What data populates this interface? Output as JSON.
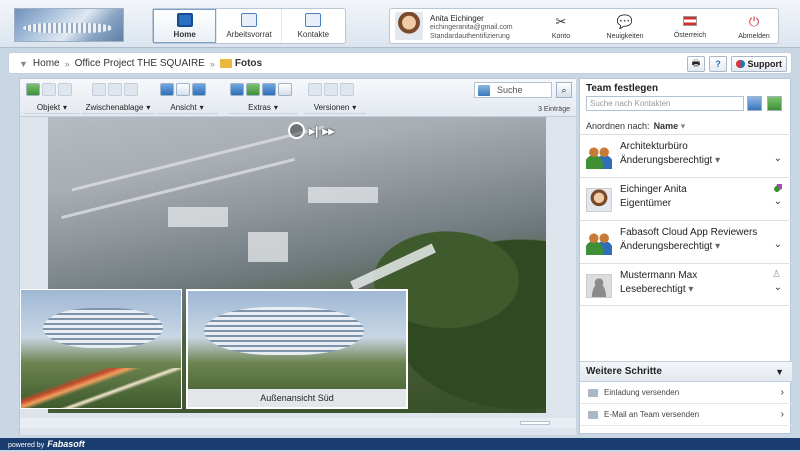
{
  "nav": {
    "items": [
      {
        "label": "Home",
        "icon": "home-icon",
        "active": true
      },
      {
        "label": "Arbeitsvorrat",
        "icon": "worklist-icon",
        "active": false
      },
      {
        "label": "Kontakte",
        "icon": "contacts-icon",
        "active": false
      }
    ]
  },
  "user": {
    "name": "Anita Eichinger",
    "email": "eichingeranita@gmail.com",
    "auth": "Standardauthentifizierung",
    "actions": [
      {
        "label": "Konto",
        "icon": "tools-icon",
        "symbol": "✂",
        "color": "#333333"
      },
      {
        "label": "Neuigkeiten",
        "icon": "chat-icon",
        "symbol": "💬",
        "color": "#2a6fc0"
      },
      {
        "label": "Österreich",
        "icon": "flag-icon",
        "symbol": "▬",
        "color": "#d22f2f"
      },
      {
        "label": "Abmelden",
        "icon": "power-icon",
        "symbol": "⏻",
        "color": "#d22f2f"
      }
    ]
  },
  "breadcrumb": {
    "items": [
      "Home",
      "Office Project THE SQUAIRE",
      "Fotos"
    ]
  },
  "header_tools": {
    "support_label": "Support"
  },
  "toolbar": {
    "menus": [
      "Objekt",
      "Zwischenablage",
      "Ansicht",
      "Extras",
      "Versionen"
    ],
    "search_placeholder": "Suche",
    "count": "3 Einträge"
  },
  "photos": {
    "thumb_caption": "Außenansicht Süd"
  },
  "team": {
    "title": "Team festlegen",
    "search_placeholder": "Suche nach Kontakten",
    "sort_label": "Anordnen nach:",
    "sort_value": "Name",
    "members": [
      {
        "name": "Architekturbüro",
        "role": "Änderungsberechtigt",
        "avatar": "group"
      },
      {
        "name": "Eichinger Anita",
        "role": "Eigentümer",
        "avatar": "face"
      },
      {
        "name": "Fabasoft Cloud App Reviewers",
        "role": "Änderungsberechtigt",
        "avatar": "group"
      },
      {
        "name": "Mustermann Max",
        "role": "Leseberechtigt",
        "avatar": "anon"
      }
    ]
  },
  "further": {
    "title": "Weitere Schritte",
    "items": [
      "Einladung versenden",
      "E-Mail an Team versenden"
    ]
  },
  "footer": {
    "powered": "powered by",
    "brand": "Fabasoft"
  }
}
